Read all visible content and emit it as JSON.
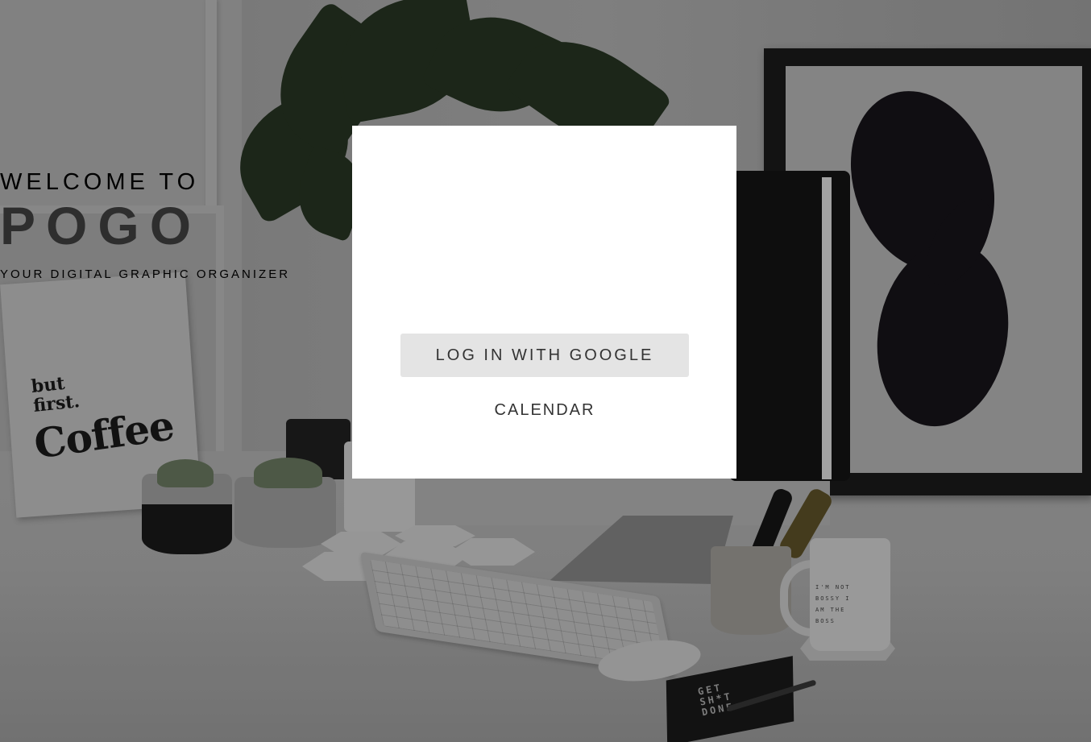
{
  "login": {
    "welcome": "WELCOME TO",
    "brand": "POGO",
    "tagline": "YOUR DIGITAL GRAPHIC ORGANIZER",
    "google_button": "LOG IN WITH GOOGLE",
    "calendar_link": "CALENDAR"
  },
  "background": {
    "poster_line_1": "but first.",
    "poster_line_2": "Coffee",
    "mug_text": "I'M NOT BOSSY I AM THE BOSS",
    "notebook_text": "GET SH*T DONE"
  },
  "colors": {
    "card": "#ffffff",
    "text": "#333333",
    "button_bg": "#e4e4e4"
  }
}
